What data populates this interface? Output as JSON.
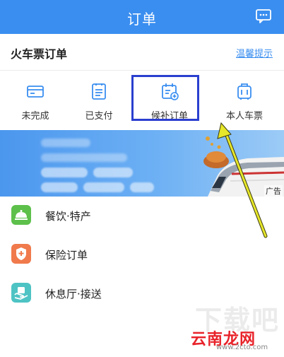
{
  "header": {
    "title": "订单",
    "chat_icon": "chat-bubble-icon",
    "background_color": "#3a8ef0"
  },
  "section": {
    "title": "火车票订单",
    "tip_link": "温馨提示"
  },
  "order_types": [
    {
      "label": "未完成",
      "icon": "card-icon"
    },
    {
      "label": "已支付",
      "icon": "document-icon"
    },
    {
      "label": "候补订单",
      "icon": "calendar-add-icon"
    },
    {
      "label": "本人车票",
      "icon": "suitcase-icon"
    }
  ],
  "banner": {
    "ad_label": "广告"
  },
  "menu": [
    {
      "label": "餐饮·特产",
      "icon": "food-cloche-icon",
      "color": "#5cc04a"
    },
    {
      "label": "保险订单",
      "icon": "shield-plus-icon",
      "color": "#f07a4c"
    },
    {
      "label": "休息厅·接送",
      "icon": "lounge-icon",
      "color": "#4ec3c4"
    }
  ],
  "watermark": {
    "logo": "云南龙网",
    "url": "www.2cto.com",
    "ghost": "下载吧"
  },
  "annotation": {
    "highlight_color": "#2a3fcf",
    "arrow_color": "#e6e62a"
  }
}
